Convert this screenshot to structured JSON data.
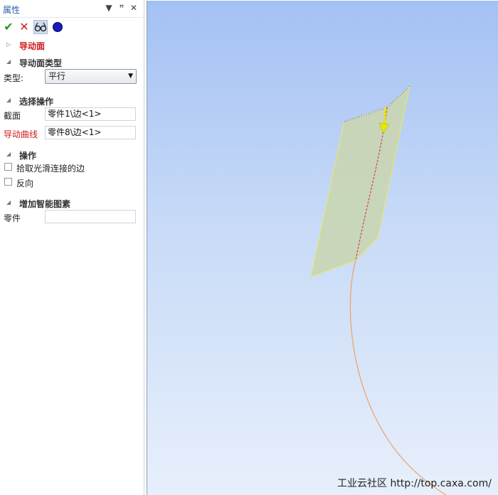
{
  "panel": {
    "title": "属性",
    "header_buttons": {
      "dropdown": "▼",
      "pin": "ꟸ",
      "close": "✕"
    },
    "toolbar": {
      "ok_icon": "checkmark-icon",
      "cancel_icon": "x-icon",
      "preview_icon": "glasses-icon",
      "apply_icon": "blue-dot-icon"
    },
    "sections": {
      "sweep": {
        "title": "导动面"
      },
      "sweep_type": {
        "title": "导动面类型",
        "type_label": "类型:",
        "type_value": "平行"
      },
      "select_op": {
        "title": "选择操作",
        "section_label": "截面",
        "section_value": "零件1\\边<1>",
        "curve_label": "导动曲线",
        "curve_value": "零件8\\边<1>"
      },
      "operation": {
        "title": "操作",
        "pick_smooth_label": "拾取光滑连接的边",
        "reverse_label": "反向"
      },
      "smart": {
        "title": "增加智能图素",
        "part_label": "零件",
        "part_value": ""
      }
    }
  },
  "watermark": "工业云社区 http://top.caxa.com/",
  "colors": {
    "accent_red": "#cc1a1a",
    "title_blue": "#2a5fa8",
    "surface_fill": "#c9d6b6",
    "surface_edge": "#e8e86a",
    "curve": "#f0a060",
    "arrow": "#e6e600"
  }
}
